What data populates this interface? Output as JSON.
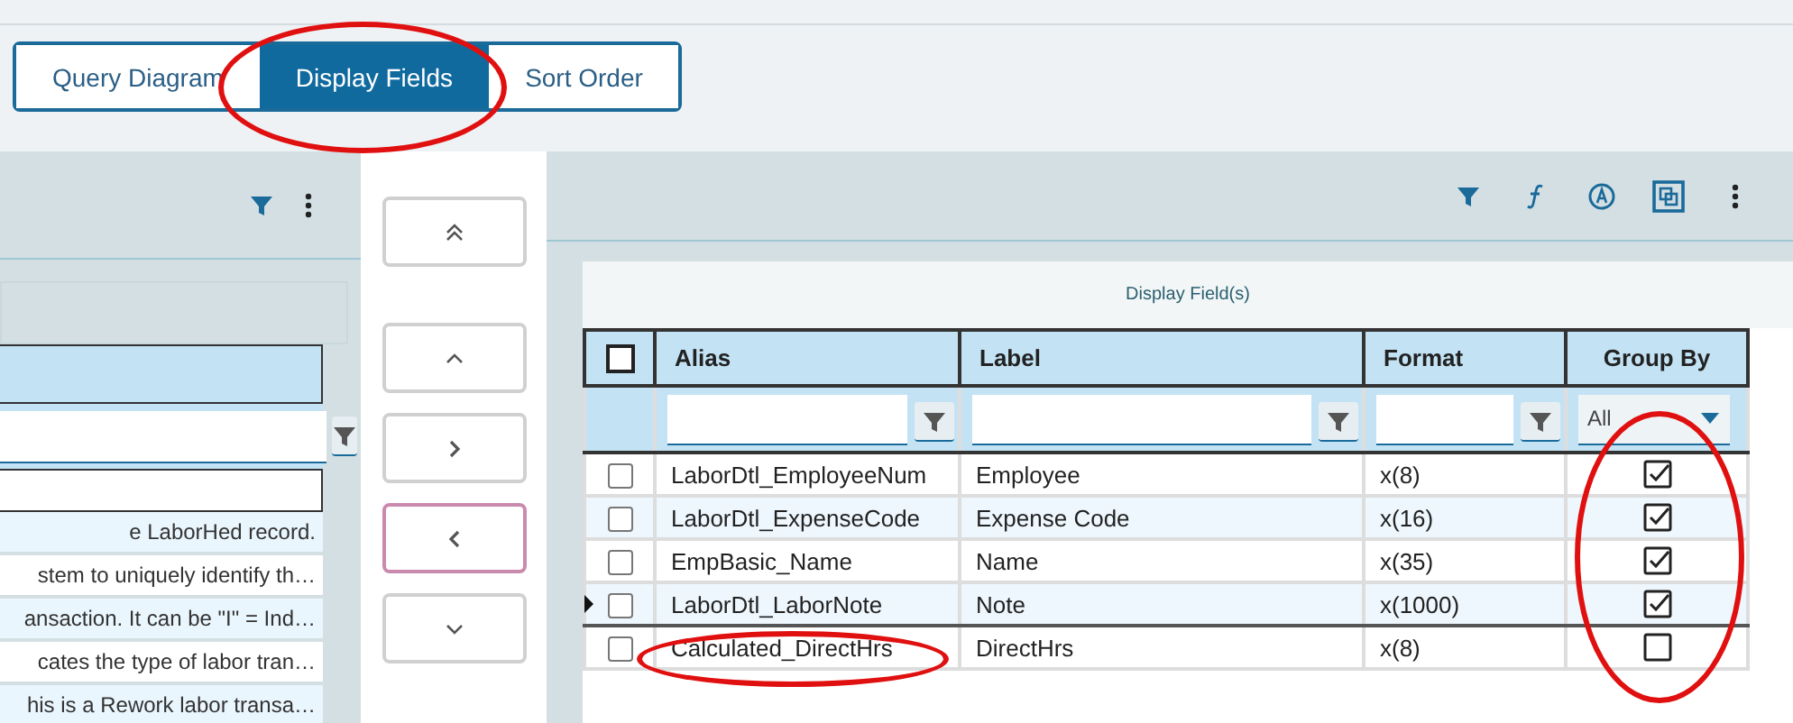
{
  "tabs": [
    {
      "label": "Query Diagram",
      "selected": false,
      "circled": false
    },
    {
      "label": "Display Fields",
      "selected": true,
      "circled": true
    },
    {
      "label": "Sort Order",
      "selected": false,
      "circled": false
    }
  ],
  "left_panel": {
    "rows": [
      "e LaborHed record.",
      "stem to uniquely identify th…",
      "ansaction. It can be \"I\" = Ind…",
      "cates the type of labor tran…",
      "his is a Rework labor transa…"
    ]
  },
  "move_buttons": [
    {
      "kind": "top",
      "focused": false
    },
    {
      "kind": "up",
      "focused": false
    },
    {
      "kind": "right",
      "focused": false
    },
    {
      "kind": "left",
      "focused": true
    },
    {
      "kind": "down",
      "focused": false
    }
  ],
  "grid": {
    "title": "Display Field(s)",
    "all_checked": false,
    "columns": [
      {
        "label": "Alias",
        "kind": "text",
        "circled": false
      },
      {
        "label": "Label",
        "kind": "text",
        "circled": false
      },
      {
        "label": "Format",
        "kind": "text",
        "circled": false
      },
      {
        "label": "Group By",
        "kind": "select",
        "filter_value": "All",
        "circled": true
      }
    ],
    "rows": [
      {
        "checked": false,
        "current": false,
        "alias": "LaborDtl_EmployeeNum",
        "alias_circled": false,
        "label": "Employee",
        "format": "x(8)",
        "group_by": true
      },
      {
        "checked": false,
        "current": false,
        "alias": "LaborDtl_ExpenseCode",
        "alias_circled": false,
        "label": "Expense Code",
        "format": "x(16)",
        "group_by": true
      },
      {
        "checked": false,
        "current": false,
        "alias": "EmpBasic_Name",
        "alias_circled": false,
        "label": "Name",
        "format": "x(35)",
        "group_by": true
      },
      {
        "checked": false,
        "current": true,
        "alias": "LaborDtl_LaborNote",
        "alias_circled": false,
        "label": "Note",
        "format": "x(1000)",
        "group_by": true
      },
      {
        "checked": false,
        "current": false,
        "alias": "Calculated_DirectHrs",
        "alias_circled": true,
        "label": "DirectHrs",
        "format": "x(8)",
        "group_by": false
      }
    ]
  }
}
